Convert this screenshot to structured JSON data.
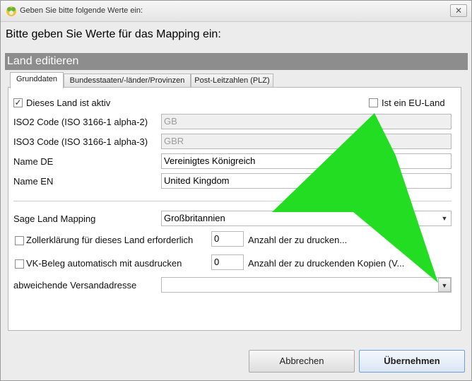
{
  "window": {
    "title": "Geben Sie bitte folgende Werte ein:",
    "close_label": "✕"
  },
  "dialog": {
    "heading": "Bitte geben Sie Werte für das Mapping ein:",
    "section_title": "Land editieren"
  },
  "tabs": [
    {
      "label": "Grunddaten",
      "active": true
    },
    {
      "label": "Bundesstaaten/-länder/Provinzen",
      "active": false
    },
    {
      "label": "Post-Leitzahlen (PLZ)",
      "active": false
    }
  ],
  "form": {
    "active_checkbox": {
      "label": "Dieses Land ist aktiv",
      "checked": true
    },
    "eu_checkbox": {
      "label": "Ist ein EU-Land",
      "checked": false
    },
    "iso2": {
      "label": "ISO2 Code (ISO 3166-1 alpha-2)",
      "value": "GB"
    },
    "iso3": {
      "label": "ISO3 Code (ISO 3166-1 alpha-3)",
      "value": "GBR"
    },
    "name_de": {
      "label": "Name DE",
      "value": "Vereinigtes Königreich"
    },
    "name_en": {
      "label": "Name EN",
      "value": "United Kingdom"
    },
    "sage_mapping": {
      "label": "Sage Land Mapping",
      "value": "Großbritannien"
    },
    "customs": {
      "label": "Zollerklärung für dieses Land erforderlich",
      "checked": false,
      "copies": "0",
      "copies_label": "Anzahl der zu drucken..."
    },
    "vk_beleg": {
      "label": "VK-Beleg automatisch mit ausdrucken",
      "checked": false,
      "copies": "0",
      "copies_label": "Anzahl der zu druckenden Kopien (V..."
    },
    "shipping_address": {
      "label": "abweichende Versandadresse",
      "value": ""
    }
  },
  "buttons": {
    "cancel": "Abbrechen",
    "apply": "Übernehmen"
  },
  "icons": {
    "app": "app-logo-icon",
    "dropdown": "chevron-down-icon"
  },
  "colors": {
    "section_bar": "#8d8d8d",
    "overlay_arrow": "#22dd22"
  }
}
